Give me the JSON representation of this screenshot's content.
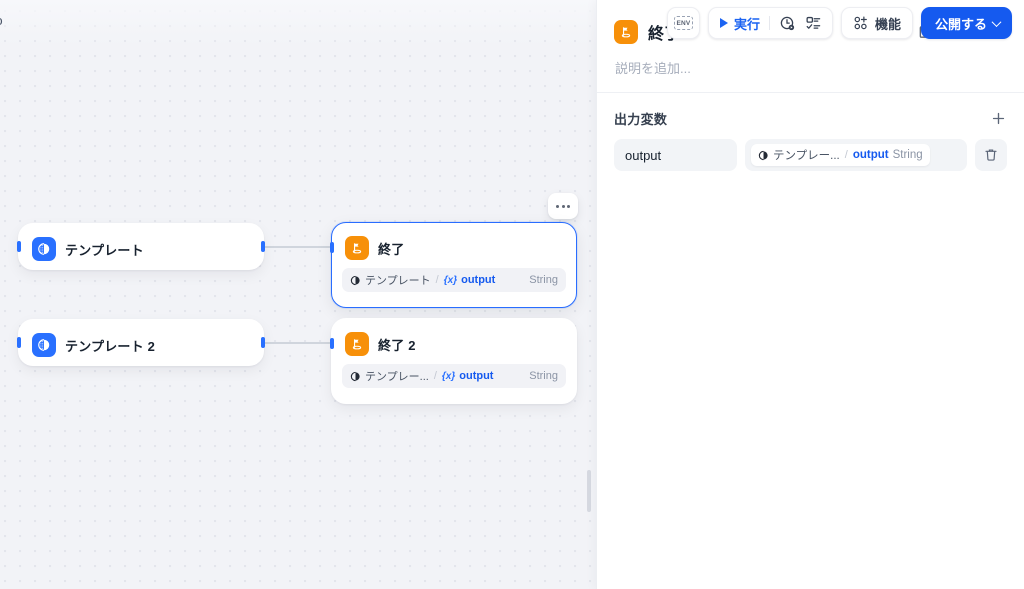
{
  "canvas": {
    "breadcrumb_clipped": "go",
    "node_menu_icon": "ellipsis-icon",
    "nodes": [
      {
        "id": "template-1",
        "title": "テンプレート",
        "icon": "template-node-icon",
        "type": "template"
      },
      {
        "id": "template-2",
        "title": "テンプレート 2",
        "icon": "template-node-icon",
        "type": "template"
      },
      {
        "id": "end-1",
        "title": "終了",
        "icon": "end-node-icon",
        "type": "end",
        "selected": true,
        "variable": {
          "source": "テンプレート",
          "separator": "/",
          "prefix": "{x}",
          "name": "output",
          "type": "String"
        }
      },
      {
        "id": "end-2",
        "title": "終了 2",
        "icon": "end-node-icon",
        "type": "end",
        "selected": false,
        "variable": {
          "source": "テンプレー...",
          "separator": "/",
          "prefix": "{x}",
          "name": "output",
          "type": "String"
        }
      }
    ]
  },
  "toolbar": {
    "env_label": "ENV",
    "env_icon": "env-badge-icon",
    "run_label": "実行",
    "run_icon": "play-icon",
    "history_icon": "run-history-icon",
    "checklist_icon": "checklist-icon",
    "feature_label": "機能",
    "feature_icon": "features-icon",
    "publish_label": "公開する",
    "publish_chevron_icon": "chevron-down-icon",
    "accent_color": "#155aef"
  },
  "panel": {
    "icon": "end-node-icon",
    "title": "終了",
    "description_placeholder": "説明を追加...",
    "help_icon": "book-icon",
    "more_icon": "ellipsis-icon",
    "close_icon": "close-icon",
    "output_section": {
      "title": "出力変数",
      "add_icon": "plus-icon",
      "delete_icon": "trash-icon",
      "rows": [
        {
          "key": "output",
          "value_source": "テンプレー...",
          "value_separator": "/",
          "value_name": "output",
          "value_type": "String"
        }
      ]
    }
  }
}
